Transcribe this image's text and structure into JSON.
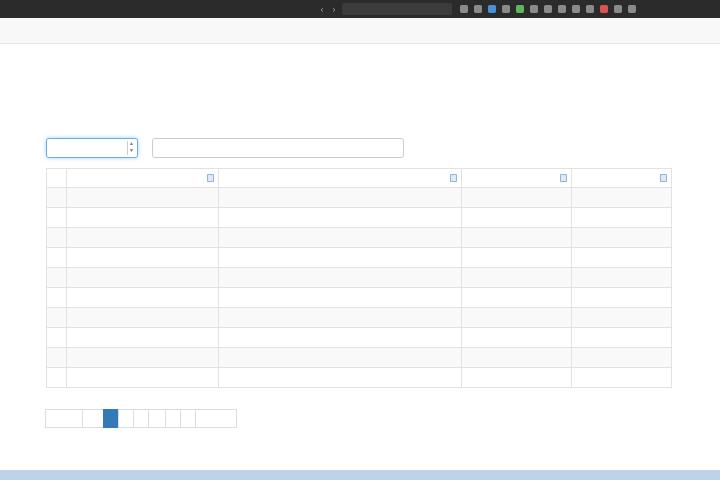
{
  "browser": {
    "title": "",
    "url": ""
  },
  "navbar": {
    "items": [
      {
        "label": ""
      },
      {
        "label": ""
      },
      {
        "label": ""
      }
    ],
    "right_label": ""
  },
  "page": {
    "title": "",
    "filter_prefix": "",
    "filter_link": ""
  },
  "controls": {
    "page_size_label": "",
    "page_size_value": "",
    "search_label": "",
    "search_placeholder": ""
  },
  "table": {
    "headers": [
      "",
      "",
      "",
      "",
      ""
    ],
    "rows": [
      [
        "",
        "",
        "",
        "",
        ""
      ],
      [
        "",
        "",
        "",
        "",
        ""
      ],
      [
        "",
        "",
        "",
        "",
        ""
      ],
      [
        "",
        "",
        "",
        "",
        ""
      ],
      [
        "",
        "",
        "",
        "",
        ""
      ],
      [
        "",
        "",
        "",
        "",
        ""
      ],
      [
        "",
        "",
        "",
        "",
        ""
      ],
      [
        "",
        "",
        "",
        "",
        ""
      ],
      [
        "",
        "",
        "",
        "",
        ""
      ],
      [
        "",
        "",
        "",
        "",
        ""
      ]
    ]
  },
  "pagination": {
    "first": "",
    "prev": "",
    "pages": [
      "",
      "",
      "",
      "",
      ""
    ],
    "next": "",
    "last": ""
  },
  "colors": {
    "accent": "#337ab7",
    "focus": "#66afe9",
    "chrome": "#2b2b2b"
  }
}
